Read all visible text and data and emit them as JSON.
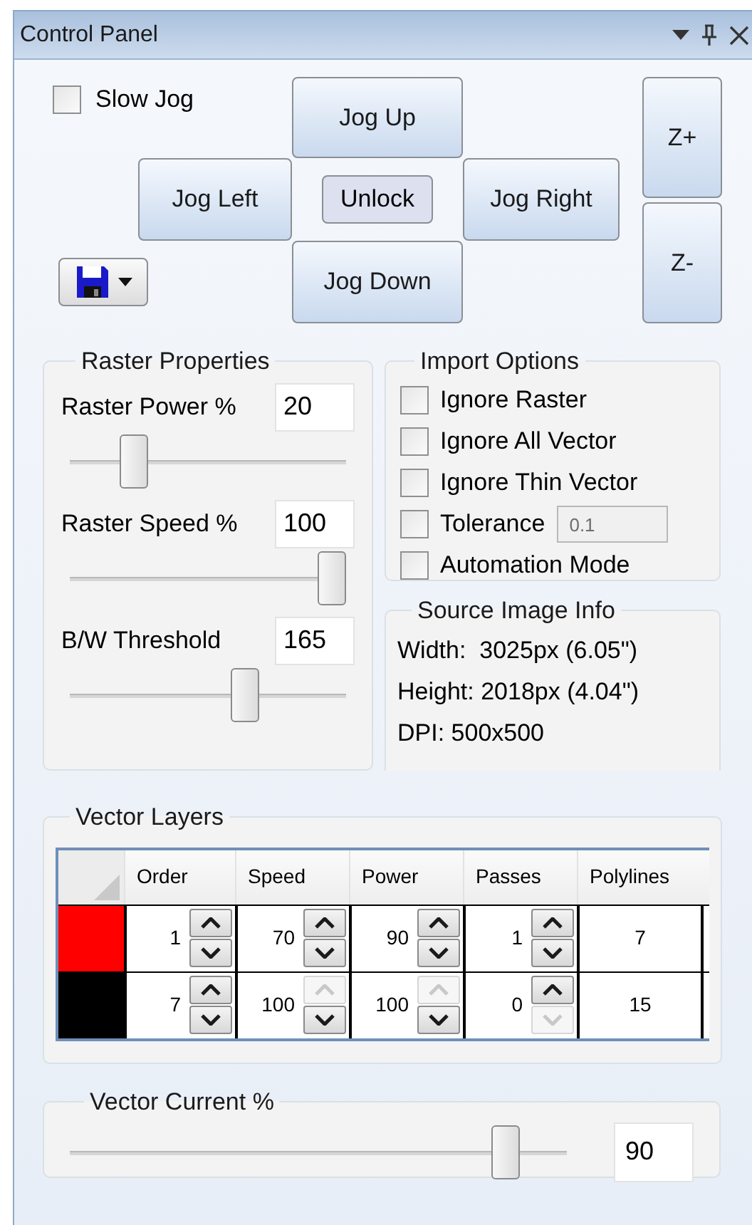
{
  "window": {
    "title": "Control Panel"
  },
  "jog": {
    "slow_jog": {
      "label": "Slow Jog",
      "checked": false
    },
    "jog_up": "Jog Up",
    "jog_left": "Jog Left",
    "unlock": "Unlock",
    "jog_right": "Jog Right",
    "jog_down": "Jog Down",
    "z_plus": "Z+",
    "z_minus": "Z-"
  },
  "raster": {
    "title": "Raster Properties",
    "sliders": [
      {
        "label": "Raster Power %",
        "value": "20",
        "level": 0.2
      },
      {
        "label": "Raster Speed %",
        "value": "100",
        "level": 1
      },
      {
        "label": "B/W Threshold",
        "value": "165",
        "level": 0.65
      }
    ]
  },
  "import_options": {
    "title": "Import Options",
    "options": [
      {
        "label": "Ignore Raster",
        "checked": false
      },
      {
        "label": "Ignore All Vector",
        "checked": false
      },
      {
        "label": "Ignore Thin Vector",
        "checked": false
      },
      {
        "label": "Tolerance",
        "checked": false,
        "field": {
          "value": "0.1",
          "disabled": true
        }
      },
      {
        "label": "Automation Mode",
        "checked": false
      }
    ]
  },
  "source_info": {
    "title": "Source Image Info",
    "lines": [
      "Width:  3025px (6.05\")",
      "Height: 2018px (4.04\")",
      "DPI: 500x500"
    ]
  },
  "vector_layers": {
    "title": "Vector Layers",
    "columns": [
      "Order",
      "Speed",
      "Power",
      "Passes",
      "Polylines"
    ],
    "rows": [
      {
        "color": "#ff0000",
        "cells": [
          {
            "value": "1",
            "up_disabled": false,
            "down_disabled": false
          },
          {
            "value": "70",
            "up_disabled": false,
            "down_disabled": false
          },
          {
            "value": "90",
            "up_disabled": false,
            "down_disabled": false
          },
          {
            "value": "1",
            "up_disabled": false,
            "down_disabled": false
          }
        ],
        "polylines": "7"
      },
      {
        "color": "#000000",
        "cells": [
          {
            "value": "7",
            "up_disabled": false,
            "down_disabled": false
          },
          {
            "value": "100",
            "up_disabled": true,
            "down_disabled": false
          },
          {
            "value": "100",
            "up_disabled": true,
            "down_disabled": false
          },
          {
            "value": "0",
            "up_disabled": false,
            "down_disabled": true
          }
        ],
        "polylines": "15"
      }
    ]
  },
  "vector_current": {
    "title": "Vector Current %",
    "level": 0.9,
    "value": "90"
  }
}
